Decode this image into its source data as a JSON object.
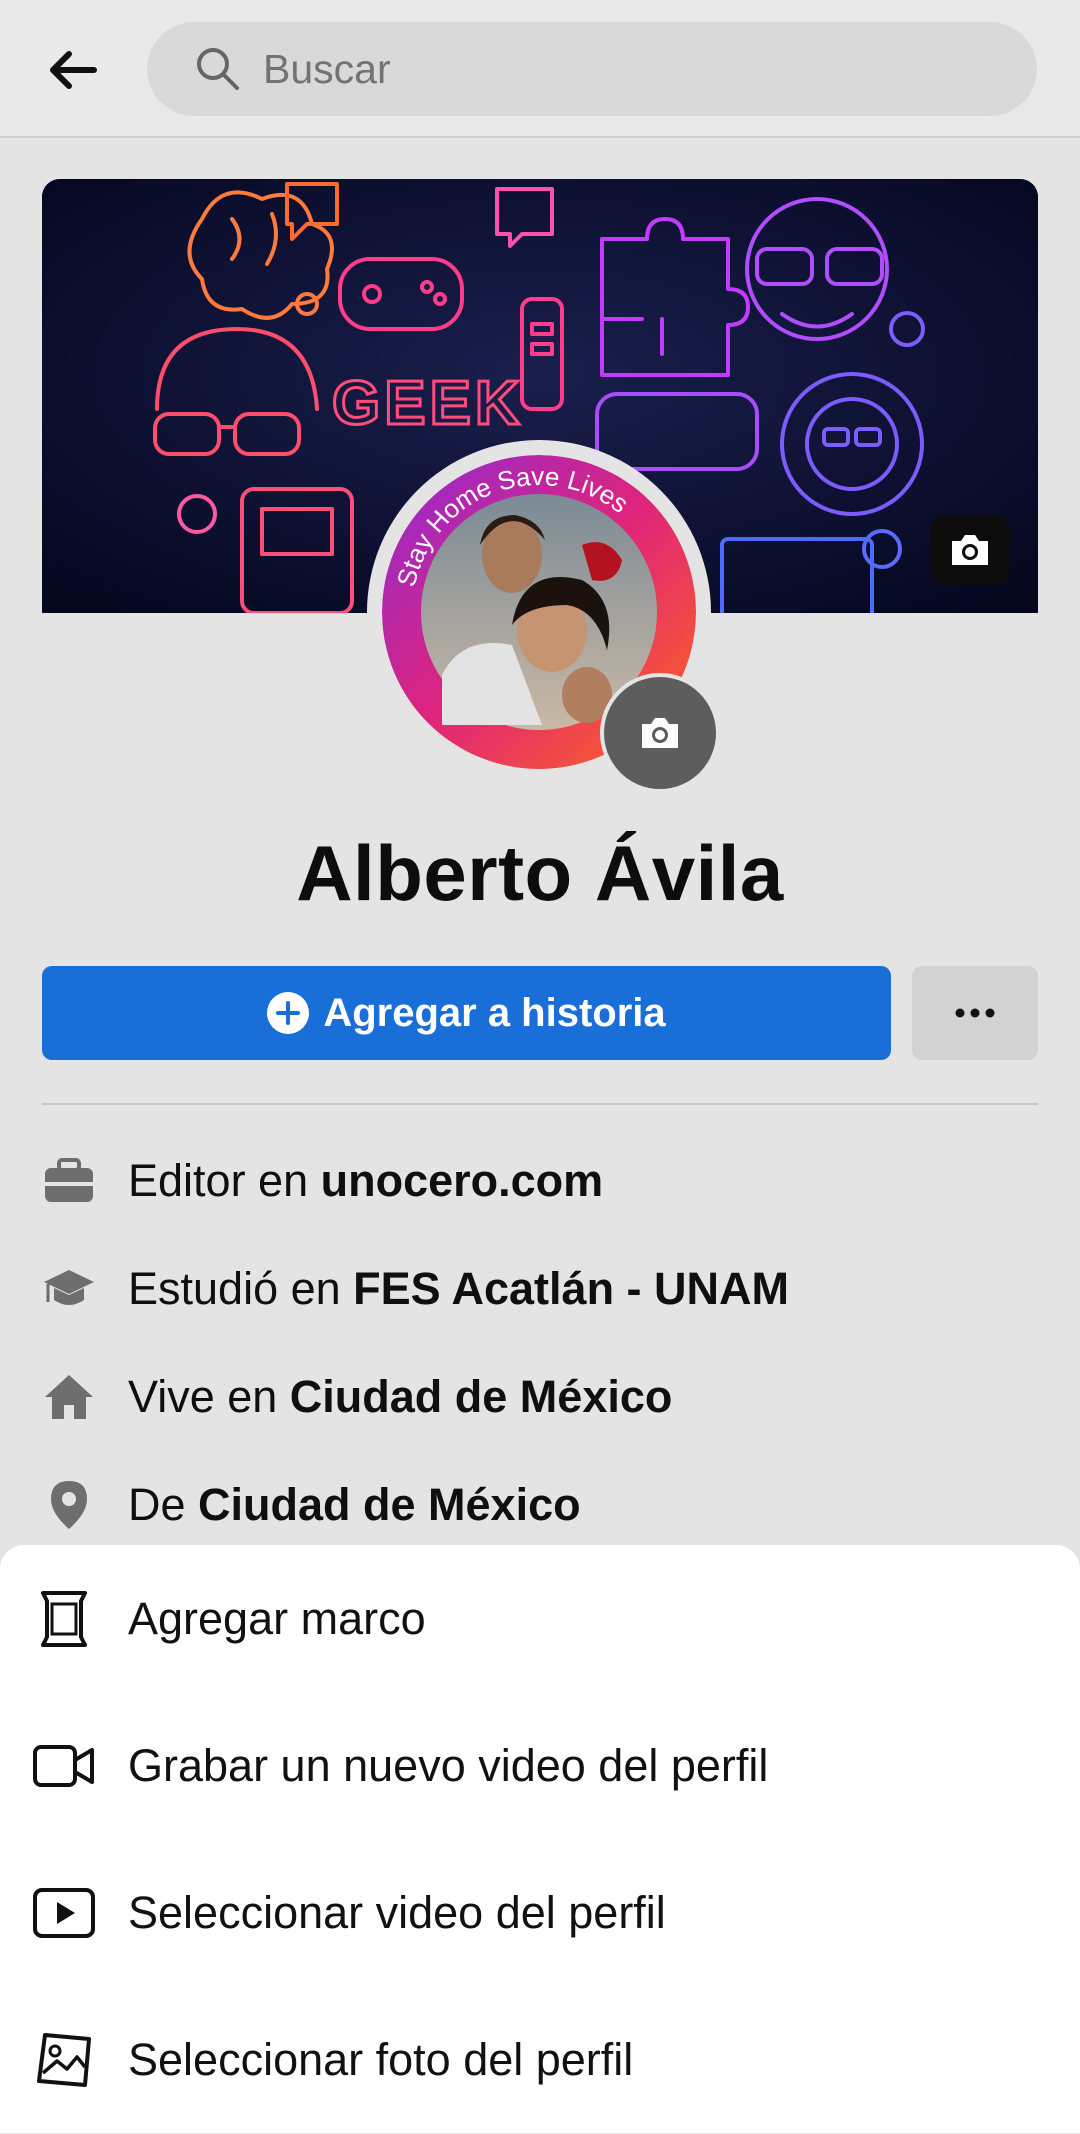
{
  "header": {
    "back_icon": "arrow-left-icon",
    "search_icon": "search-icon",
    "search_placeholder": "Buscar"
  },
  "cover": {
    "camera_icon": "camera-icon",
    "brand_colors": [
      "#ff7a3d",
      "#c23cff",
      "#4d6bff",
      "#ff3d8b"
    ]
  },
  "profile": {
    "name": "Alberto Ávila",
    "frame_text": "Stay Home Save Lives",
    "camera_icon": "camera-icon"
  },
  "actions": {
    "add_story_label": "Agregar a historia",
    "more_icon": "more-dots-icon",
    "accent_color": "#1a6ed8"
  },
  "info": [
    {
      "icon": "briefcase-icon",
      "prefix": "Editor en ",
      "value": "unocero.com"
    },
    {
      "icon": "graduation-cap-icon",
      "prefix": "Estudió en ",
      "value": "FES Acatlán - UNAM"
    },
    {
      "icon": "home-icon",
      "prefix": "Vive en ",
      "value": "Ciudad de México"
    },
    {
      "icon": "location-pin-icon",
      "prefix": "De ",
      "value": "Ciudad de México"
    }
  ],
  "sheet": {
    "items": [
      {
        "icon": "frame-icon",
        "label": "Agregar marco"
      },
      {
        "icon": "video-camera-icon",
        "label": "Grabar un nuevo video del perfil"
      },
      {
        "icon": "play-video-icon",
        "label": "Seleccionar video del perfil"
      },
      {
        "icon": "image-icon",
        "label": "Seleccionar foto del perfil"
      }
    ]
  }
}
